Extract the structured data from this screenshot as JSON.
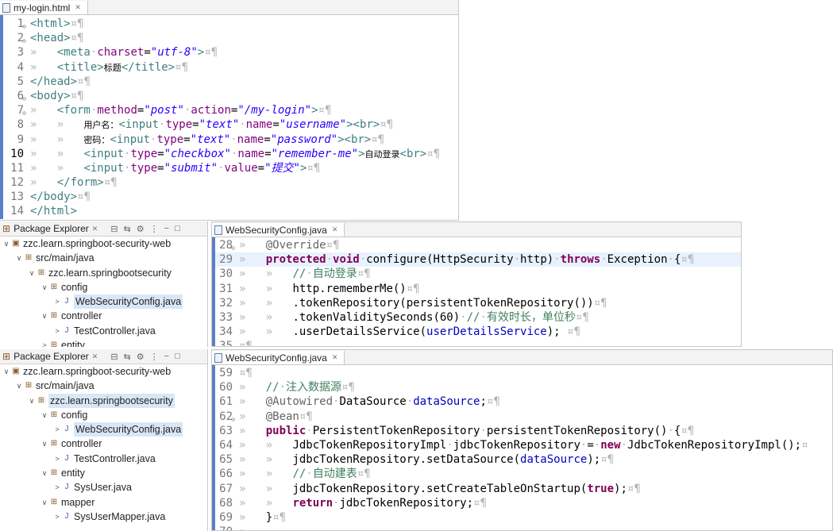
{
  "html_editor": {
    "tab_title": "my-login.html",
    "lines": [
      {
        "n": "1",
        "fold": "⊖",
        "segs": [
          [
            "t-tag",
            "<html>"
          ],
          [
            "t-ws",
            "¤¶"
          ]
        ]
      },
      {
        "n": "2",
        "fold": "⊖",
        "segs": [
          [
            "t-tag",
            "<head>"
          ],
          [
            "t-ws",
            "¤¶"
          ]
        ]
      },
      {
        "n": "3",
        "segs": [
          [
            "t-ws",
            "»   "
          ],
          [
            "t-tag",
            "<meta"
          ],
          [
            "t-ws",
            "·"
          ],
          [
            "t-attr",
            "charset"
          ],
          [
            "",
            "="
          ],
          [
            "t-str",
            "\"utf-8\""
          ],
          [
            "t-tag",
            ">"
          ],
          [
            "t-ws",
            "¤¶"
          ]
        ]
      },
      {
        "n": "4",
        "segs": [
          [
            "t-ws",
            "»   "
          ],
          [
            "t-tag",
            "<title>"
          ],
          [
            "t-cjk",
            "标题"
          ],
          [
            "t-tag",
            "</title>"
          ],
          [
            "t-ws",
            "¤¶"
          ]
        ]
      },
      {
        "n": "5",
        "segs": [
          [
            "t-tag",
            "</head>"
          ],
          [
            "t-ws",
            "¤¶"
          ]
        ]
      },
      {
        "n": "6",
        "fold": "⊖",
        "segs": [
          [
            "t-tag",
            "<body>"
          ],
          [
            "t-ws",
            "¤¶"
          ]
        ]
      },
      {
        "n": "7",
        "fold": "⊖",
        "segs": [
          [
            "t-ws",
            "»   "
          ],
          [
            "t-tag",
            "<form"
          ],
          [
            "t-ws",
            "·"
          ],
          [
            "t-attr",
            "method"
          ],
          [
            "",
            "="
          ],
          [
            "t-str",
            "\"post\""
          ],
          [
            "t-ws",
            "·"
          ],
          [
            "t-attr",
            "action"
          ],
          [
            "",
            "="
          ],
          [
            "t-str",
            "\"/my-login\""
          ],
          [
            "t-tag",
            ">"
          ],
          [
            "t-ws",
            "¤¶"
          ]
        ]
      },
      {
        "n": "8",
        "segs": [
          [
            "t-ws",
            "»   »   "
          ],
          [
            "t-cjk",
            "用户名："
          ],
          [
            "t-tag",
            "<input"
          ],
          [
            "t-ws",
            "·"
          ],
          [
            "t-attr",
            "type"
          ],
          [
            "",
            "="
          ],
          [
            "t-str",
            "\"text\""
          ],
          [
            "t-ws",
            "·"
          ],
          [
            "t-attr",
            "name"
          ],
          [
            "",
            "="
          ],
          [
            "t-str",
            "\"username\""
          ],
          [
            "t-tag",
            ">"
          ],
          [
            "t-tag",
            "<br>"
          ],
          [
            "t-ws",
            "¤¶"
          ]
        ]
      },
      {
        "n": "9",
        "segs": [
          [
            "t-ws",
            "»   »   "
          ],
          [
            "t-cjk",
            "密码："
          ],
          [
            "t-tag",
            "<input"
          ],
          [
            "t-ws",
            "·"
          ],
          [
            "t-attr",
            "type"
          ],
          [
            "",
            "="
          ],
          [
            "t-str",
            "\"text\""
          ],
          [
            "t-ws",
            "·"
          ],
          [
            "t-attr",
            "name"
          ],
          [
            "",
            "="
          ],
          [
            "t-str",
            "\"password\""
          ],
          [
            "t-tag",
            ">"
          ],
          [
            "t-tag",
            "<br>"
          ],
          [
            "t-ws",
            "¤¶"
          ]
        ]
      },
      {
        "n": "10",
        "cursor": true,
        "segs": [
          [
            "t-ws",
            "»   »   "
          ],
          [
            "t-tag",
            "<input"
          ],
          [
            "t-ws",
            "·"
          ],
          [
            "t-attr",
            "type"
          ],
          [
            "",
            "="
          ],
          [
            "t-str",
            "\"checkbox\""
          ],
          [
            "t-ws",
            "·"
          ],
          [
            "t-attr",
            "name"
          ],
          [
            "",
            "="
          ],
          [
            "t-str",
            "\"remember-me\""
          ],
          [
            "t-tag",
            ">"
          ],
          [
            "t-cjk",
            "自动登录"
          ],
          [
            "t-tag",
            "<br>"
          ],
          [
            "t-ws",
            "¤¶"
          ]
        ]
      },
      {
        "n": "11",
        "segs": [
          [
            "t-ws",
            "»   »   "
          ],
          [
            "t-tag",
            "<input"
          ],
          [
            "t-ws",
            "·"
          ],
          [
            "t-attr",
            "type"
          ],
          [
            "",
            "="
          ],
          [
            "t-str",
            "\"submit\""
          ],
          [
            "t-ws",
            "·"
          ],
          [
            "t-attr",
            "value"
          ],
          [
            "",
            "="
          ],
          [
            "t-str",
            "\"提交\""
          ],
          [
            "t-tag",
            ">"
          ],
          [
            "t-ws",
            "¤¶"
          ]
        ]
      },
      {
        "n": "12",
        "segs": [
          [
            "t-ws",
            "»   "
          ],
          [
            "t-tag",
            "</form>"
          ],
          [
            "t-ws",
            "¤¶"
          ]
        ]
      },
      {
        "n": "13",
        "segs": [
          [
            "t-tag",
            "</body>"
          ],
          [
            "t-ws",
            "¤¶"
          ]
        ]
      },
      {
        "n": "14",
        "segs": [
          [
            "t-tag",
            "</html>"
          ]
        ]
      }
    ]
  },
  "explorer_top": {
    "title": "Package Explorer",
    "items": [
      {
        "indent": 0,
        "tw": "∨",
        "icon": "▣",
        "label": "zzc.learn.springboot-security-web"
      },
      {
        "indent": 1,
        "tw": "∨",
        "icon": "⊞",
        "label": "src/main/java"
      },
      {
        "indent": 2,
        "tw": "∨",
        "icon": "⊞",
        "label": "zzc.learn.springbootsecurity"
      },
      {
        "indent": 3,
        "tw": "∨",
        "icon": "⊞",
        "label": "config"
      },
      {
        "indent": 4,
        "tw": ">",
        "icon": "J",
        "java": true,
        "sel": true,
        "label": "WebSecurityConfig.java"
      },
      {
        "indent": 3,
        "tw": "∨",
        "icon": "⊞",
        "label": "controller"
      },
      {
        "indent": 4,
        "tw": ">",
        "icon": "J",
        "java": true,
        "label": "TestController.java"
      },
      {
        "indent": 3,
        "tw": ">",
        "icon": "⊞",
        "label": "entity"
      }
    ]
  },
  "java_editor_top": {
    "tab_title": "WebSecurityConfig.java",
    "lines": [
      {
        "n": "28",
        "fold": "⊖",
        "segs": [
          [
            "t-ws",
            "»   "
          ],
          [
            "t-ann",
            "@Override"
          ],
          [
            "t-ws",
            "¤¶"
          ]
        ]
      },
      {
        "n": "29",
        "hl": true,
        "segs": [
          [
            "t-ws",
            "»   "
          ],
          [
            "t-kw",
            "protected"
          ],
          [
            "t-ws",
            "·"
          ],
          [
            "t-kw",
            "void"
          ],
          [
            "t-ws",
            "·"
          ],
          [
            "",
            "configure(HttpSecurity"
          ],
          [
            "t-ws",
            "·"
          ],
          [
            "",
            "http)"
          ],
          [
            "t-ws",
            "·"
          ],
          [
            "t-kw",
            "throws"
          ],
          [
            "t-ws",
            "·"
          ],
          [
            "",
            "Exception"
          ],
          [
            "t-ws",
            "·"
          ],
          [
            "",
            "{"
          ],
          [
            "t-ws",
            "¤¶"
          ]
        ]
      },
      {
        "n": "30",
        "segs": [
          [
            "t-ws",
            "»   »   "
          ],
          [
            "t-com",
            "//"
          ],
          [
            "t-ws",
            "·"
          ],
          [
            "t-com",
            "自动登录"
          ],
          [
            "t-ws",
            "¤¶"
          ]
        ]
      },
      {
        "n": "31",
        "segs": [
          [
            "t-ws",
            "»   »   "
          ],
          [
            "",
            "http.rememberMe()"
          ],
          [
            "t-ws",
            "¤¶"
          ]
        ]
      },
      {
        "n": "32",
        "segs": [
          [
            "t-ws",
            "»   »   "
          ],
          [
            "",
            ".tokenRepository(persistentTokenRepository())"
          ],
          [
            "t-ws",
            "¤¶"
          ]
        ]
      },
      {
        "n": "33",
        "segs": [
          [
            "t-ws",
            "»   »   "
          ],
          [
            "",
            ".tokenValiditySeconds(60)"
          ],
          [
            "t-ws",
            "·"
          ],
          [
            "t-com",
            "//"
          ],
          [
            "t-ws",
            "·"
          ],
          [
            "t-com",
            "有效时长，单位秒"
          ],
          [
            "t-ws",
            "¤¶"
          ]
        ]
      },
      {
        "n": "34",
        "segs": [
          [
            "t-ws",
            "»   »   "
          ],
          [
            "",
            ".userDetailsService("
          ],
          [
            "t-fld",
            "userDetailsService"
          ],
          [
            "",
            "); "
          ],
          [
            "t-ws",
            "¤¶"
          ]
        ]
      },
      {
        "n": "35",
        "segs": [
          [
            "t-ws",
            "¤¶"
          ]
        ]
      }
    ]
  },
  "explorer_bottom": {
    "title": "Package Explorer",
    "items": [
      {
        "indent": 0,
        "tw": "∨",
        "icon": "▣",
        "label": "zzc.learn.springboot-security-web"
      },
      {
        "indent": 1,
        "tw": "∨",
        "icon": "⊞",
        "label": "src/main/java"
      },
      {
        "indent": 2,
        "tw": "∨",
        "icon": "⊞",
        "sel": true,
        "label": "zzc.learn.springbootsecurity"
      },
      {
        "indent": 3,
        "tw": "∨",
        "icon": "⊞",
        "label": "config"
      },
      {
        "indent": 4,
        "tw": ">",
        "icon": "J",
        "java": true,
        "sel": true,
        "label": "WebSecurityConfig.java"
      },
      {
        "indent": 3,
        "tw": "∨",
        "icon": "⊞",
        "label": "controller"
      },
      {
        "indent": 4,
        "tw": ">",
        "icon": "J",
        "java": true,
        "label": "TestController.java"
      },
      {
        "indent": 3,
        "tw": "∨",
        "icon": "⊞",
        "label": "entity"
      },
      {
        "indent": 4,
        "tw": ">",
        "icon": "J",
        "java": true,
        "label": "SysUser.java"
      },
      {
        "indent": 3,
        "tw": "∨",
        "icon": "⊞",
        "label": "mapper"
      },
      {
        "indent": 4,
        "tw": ">",
        "icon": "J",
        "java": true,
        "label": "SysUserMapper.java"
      }
    ]
  },
  "java_editor_bottom": {
    "tab_title": "WebSecurityConfig.java",
    "lines": [
      {
        "n": "59",
        "segs": [
          [
            "t-ws",
            "¤¶"
          ]
        ]
      },
      {
        "n": "60",
        "segs": [
          [
            "t-ws",
            "»   "
          ],
          [
            "t-com",
            "//"
          ],
          [
            "t-ws",
            "·"
          ],
          [
            "t-com",
            "注入数据源"
          ],
          [
            "t-ws",
            "¤¶"
          ]
        ]
      },
      {
        "n": "61",
        "segs": [
          [
            "t-ws",
            "»   "
          ],
          [
            "t-ann",
            "@Autowired"
          ],
          [
            "t-ws",
            "·"
          ],
          [
            "",
            "DataSource"
          ],
          [
            "t-ws",
            "·"
          ],
          [
            "t-fld",
            "dataSource"
          ],
          [
            "",
            ";"
          ],
          [
            "t-ws",
            "¤¶"
          ]
        ]
      },
      {
        "n": "62",
        "fold": "⊖",
        "segs": [
          [
            "t-ws",
            "»   "
          ],
          [
            "t-ann",
            "@Bean"
          ],
          [
            "t-ws",
            "¤¶"
          ]
        ]
      },
      {
        "n": "63",
        "segs": [
          [
            "t-ws",
            "»   "
          ],
          [
            "t-kw",
            "public"
          ],
          [
            "t-ws",
            "·"
          ],
          [
            "",
            "PersistentTokenRepository"
          ],
          [
            "t-ws",
            "·"
          ],
          [
            "",
            "persistentTokenRepository()"
          ],
          [
            "t-ws",
            "·"
          ],
          [
            "",
            "{"
          ],
          [
            "t-ws",
            "¤¶"
          ]
        ]
      },
      {
        "n": "64",
        "segs": [
          [
            "t-ws",
            "»   »   "
          ],
          [
            "",
            "JdbcTokenRepositoryImpl"
          ],
          [
            "t-ws",
            "·"
          ],
          [
            "",
            "jdbcTokenRepository"
          ],
          [
            "t-ws",
            "·"
          ],
          [
            "",
            "="
          ],
          [
            "t-ws",
            "·"
          ],
          [
            "t-kw",
            "new"
          ],
          [
            "t-ws",
            "·"
          ],
          [
            "",
            "JdbcTokenRepositoryImpl();"
          ],
          [
            "t-ws",
            "¤"
          ]
        ]
      },
      {
        "n": "65",
        "segs": [
          [
            "t-ws",
            "»   »   "
          ],
          [
            "",
            "jdbcTokenRepository.setDataSource("
          ],
          [
            "t-fld",
            "dataSource"
          ],
          [
            "",
            ");"
          ],
          [
            "t-ws",
            "¤¶"
          ]
        ]
      },
      {
        "n": "66",
        "segs": [
          [
            "t-ws",
            "»   »   "
          ],
          [
            "t-com",
            "//"
          ],
          [
            "t-ws",
            "·"
          ],
          [
            "t-com",
            "自动建表"
          ],
          [
            "t-ws",
            "¤¶"
          ]
        ]
      },
      {
        "n": "67",
        "segs": [
          [
            "t-ws",
            "»   »   "
          ],
          [
            "",
            "jdbcTokenRepository.setCreateTableOnStartup("
          ],
          [
            "t-kw",
            "true"
          ],
          [
            "",
            ");"
          ],
          [
            "t-ws",
            "¤¶"
          ]
        ]
      },
      {
        "n": "68",
        "segs": [
          [
            "t-ws",
            "»   »   "
          ],
          [
            "t-kw",
            "return"
          ],
          [
            "t-ws",
            "·"
          ],
          [
            "",
            "jdbcTokenRepository;"
          ],
          [
            "t-ws",
            "¤¶"
          ]
        ]
      },
      {
        "n": "69",
        "segs": [
          [
            "t-ws",
            "»   "
          ],
          [
            "",
            "}"
          ],
          [
            "t-ws",
            "¤¶"
          ]
        ]
      },
      {
        "n": "70",
        "segs": [
          [
            "t-ws",
            "»   "
          ]
        ]
      }
    ]
  }
}
